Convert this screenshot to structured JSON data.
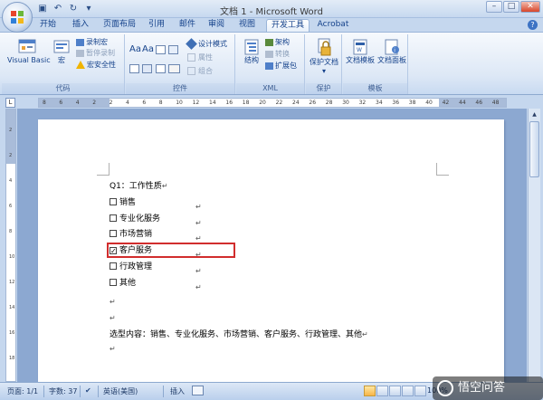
{
  "window": {
    "title": "文档 1 - Microsoft Word",
    "controls": [
      "–",
      "□",
      "✕"
    ]
  },
  "tabs": [
    {
      "label": "开始",
      "active": false
    },
    {
      "label": "插入",
      "active": false
    },
    {
      "label": "页面布局",
      "active": false
    },
    {
      "label": "引用",
      "active": false
    },
    {
      "label": "邮件",
      "active": false
    },
    {
      "label": "审阅",
      "active": false
    },
    {
      "label": "视图",
      "active": false
    },
    {
      "label": "开发工具",
      "active": true
    },
    {
      "label": "Acrobat",
      "active": false
    }
  ],
  "ribbon": {
    "code": {
      "label": "代码",
      "visual_basic": "Visual Basic",
      "macro": "宏",
      "record_macro": "录制宏",
      "pause_recording": "暂停录制",
      "macro_security": "宏安全性"
    },
    "controls": {
      "label": "控件",
      "aa1": "Aa",
      "aa2": "Aa",
      "design_mode": "设计模式",
      "properties": "属性",
      "group": "组合"
    },
    "xml": {
      "label": "XML",
      "structure": "结构",
      "schema": "架构",
      "transform": "转换",
      "expansion_pack": "扩展包"
    },
    "protect": {
      "label": "保护",
      "protect_doc": "保护文档"
    },
    "templates": {
      "label": "模板",
      "doc_template": "文档模板",
      "doc_panel": "文档面板"
    }
  },
  "ruler": {
    "corner": "L",
    "ticks": [
      "8",
      "6",
      "4",
      "2",
      "2",
      "4",
      "6",
      "8",
      "10",
      "12",
      "14",
      "16",
      "18",
      "20",
      "22",
      "24",
      "26",
      "28",
      "30",
      "32",
      "34",
      "36",
      "38",
      "40",
      "42",
      "44",
      "46",
      "48"
    ],
    "vticks": [
      "2",
      "2",
      "4",
      "6",
      "8",
      "10",
      "12",
      "14",
      "16",
      "18"
    ]
  },
  "document": {
    "question": "Q1：工作性质",
    "para_mark": "↵",
    "options": [
      {
        "label": "销售",
        "checked": false
      },
      {
        "label": "专业化服务",
        "checked": false
      },
      {
        "label": "市场营销",
        "checked": false
      },
      {
        "label": "客户服务",
        "checked": true
      },
      {
        "label": "行政管理",
        "checked": false
      },
      {
        "label": "其他",
        "checked": false
      }
    ],
    "checkmark": "✓",
    "selected_content": "选型内容：销售、专业化服务、市场营销、客户服务、行政管理、其他"
  },
  "statusbar": {
    "page": "页面: 1/1",
    "words": "字数: 37",
    "language": "英语(美国)",
    "insert_mode": "插入",
    "zoom": "100%"
  },
  "watermark": {
    "text": "悟空问答"
  },
  "colors": {
    "highlight": "#d12d2d",
    "ribbon_text": "#15428b",
    "doc_background": "#8ca8d1"
  }
}
